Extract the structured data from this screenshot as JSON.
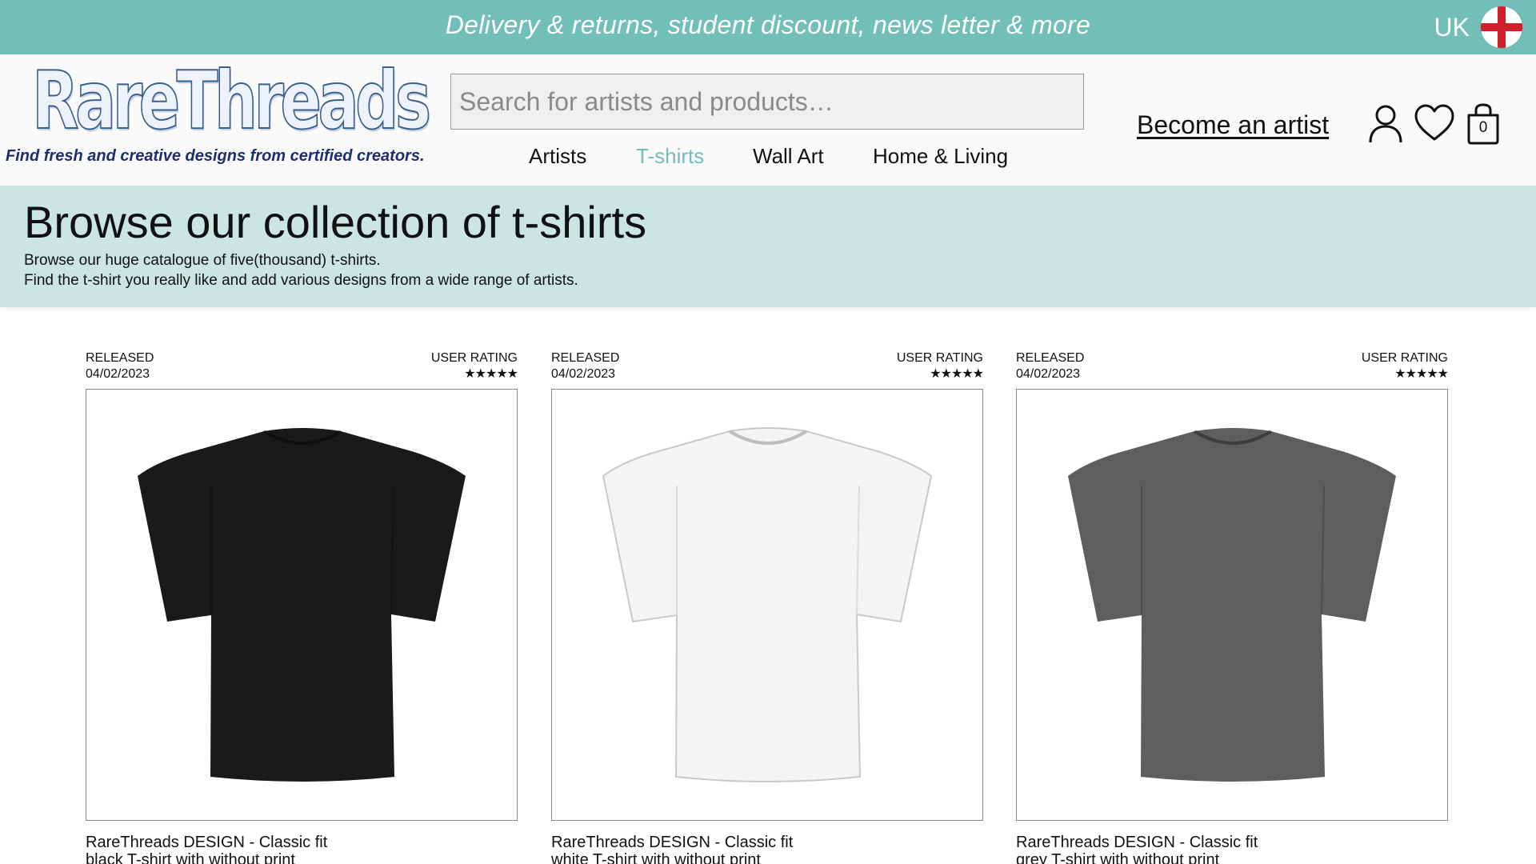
{
  "promo": {
    "text": "Delivery & returns, student discount, news letter & more",
    "region": "UK",
    "flag_icon": "england-flag-icon"
  },
  "header": {
    "logo": "RareThreads",
    "tagline": "Find fresh and creative designs from certified creators.",
    "search_placeholder": "Search for artists and products…",
    "become_artist": "Become an artist",
    "cart_count": "0",
    "icons": [
      "user-icon",
      "heart-icon",
      "shopping-bag-icon"
    ]
  },
  "nav": [
    {
      "label": "Artists",
      "active": false
    },
    {
      "label": "T-shirts",
      "active": true
    },
    {
      "label": "Wall Art",
      "active": false
    },
    {
      "label": "Home & Living",
      "active": false
    }
  ],
  "hero": {
    "title": "Browse our collection of t-shirts",
    "lines": [
      "Browse our huge catalogue of five(thousand) t-shirts.",
      "Find the t-shirt you really like and add various designs from a wide range of artists."
    ]
  },
  "products": [
    {
      "released_label": "RELEASED",
      "date": "04/02/2023",
      "rating_label": "USER RATING",
      "stars": "★★★★★",
      "rating": 5,
      "color": "#1a1a1a",
      "title": "RareThreads DESIGN - Classic fit black T-shirt with without print"
    },
    {
      "released_label": "RELEASED",
      "date": "04/02/2023",
      "rating_label": "USER RATING",
      "stars": "★★★★★",
      "rating": 5,
      "color": "#f4f4f4",
      "title": "RareThreads DESIGN - Classic fit white T-shirt with without print"
    },
    {
      "released_label": "RELEASED",
      "date": "04/02/2023",
      "rating_label": "USER RATING",
      "stars": "★★★★★",
      "rating": 5,
      "color": "#5e5e5e",
      "title": "RareThreads DESIGN - Classic fit grey T-shirt with without print"
    }
  ],
  "colors": {
    "accent": "#71bfb8",
    "hero_bg": "#cbe5e2",
    "tagline": "#1b2f70"
  }
}
